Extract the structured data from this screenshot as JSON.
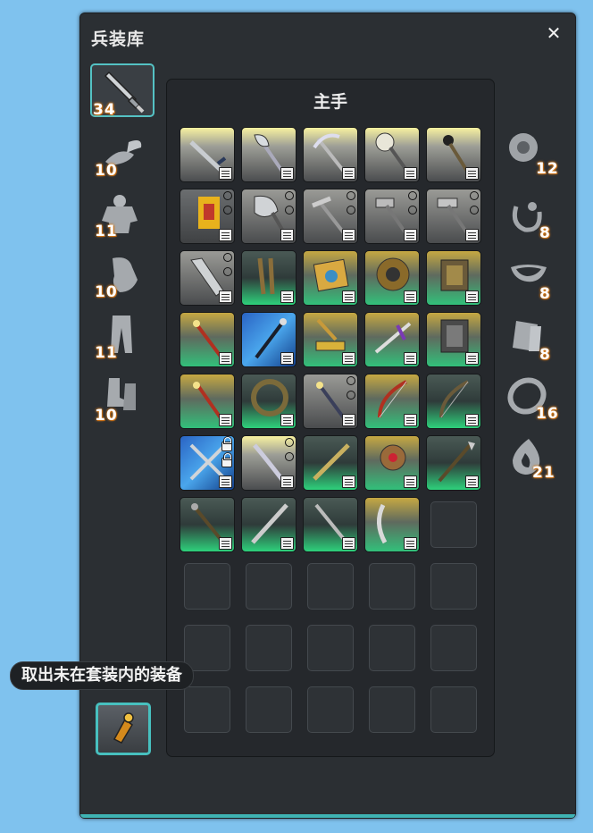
{
  "window": {
    "title": "兵装库",
    "close_label": "✕"
  },
  "panel": {
    "title": "主手"
  },
  "tooltip": {
    "text": "取出未在套装内的装备"
  },
  "left_categories": [
    {
      "name": "main-hand",
      "count": "34",
      "icon": "dagger-icon"
    },
    {
      "name": "head",
      "count": "10",
      "icon": "hat-icon"
    },
    {
      "name": "body",
      "count": "11",
      "icon": "armor-icon"
    },
    {
      "name": "hands",
      "count": "10",
      "icon": "gloves-icon"
    },
    {
      "name": "legs",
      "count": "11",
      "icon": "pants-icon"
    },
    {
      "name": "feet",
      "count": "10",
      "icon": "boots-icon"
    }
  ],
  "right_categories": [
    {
      "name": "earrings",
      "count": "12",
      "icon": "earring-icon"
    },
    {
      "name": "necklace",
      "count": "8",
      "icon": "necklace-icon"
    },
    {
      "name": "bracelet",
      "count": "8",
      "icon": "bracelet-icon"
    },
    {
      "name": "wristband",
      "count": "8",
      "icon": "wristband-icon"
    },
    {
      "name": "ring",
      "count": "16",
      "icon": "ring-icon"
    },
    {
      "name": "soul-crystal",
      "count": "21",
      "icon": "crystal-icon"
    }
  ],
  "colors": {
    "accent": "#54c2c4",
    "count_glow": "#d77d1e"
  }
}
